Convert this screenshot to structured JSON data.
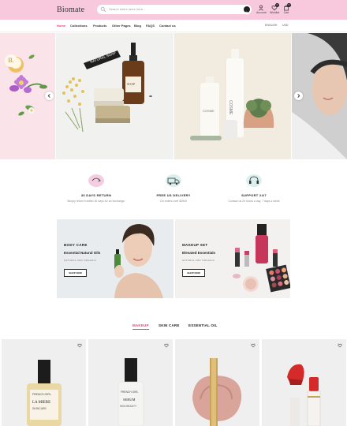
{
  "header": {
    "logo": "Biomate",
    "search": {
      "placeholder": "Search entire store here..."
    },
    "actions": [
      {
        "label": "Account",
        "icon": "user-icon"
      },
      {
        "label": "Wishlist",
        "icon": "heart-icon",
        "count": "0"
      },
      {
        "label": "Cart",
        "icon": "bag-icon",
        "count": "0"
      }
    ]
  },
  "nav": {
    "items": [
      {
        "label": "Home",
        "active": true
      },
      {
        "label": "Collections",
        "active": false
      },
      {
        "label": "Products",
        "active": false
      },
      {
        "label": "Other Pages",
        "active": false
      },
      {
        "label": "Blog",
        "active": false
      },
      {
        "label": "FAQS",
        "active": false
      },
      {
        "label": "Contact us",
        "active": false
      }
    ],
    "language": "ENGLISH",
    "currency": "USD"
  },
  "hero": {
    "soap_label_top": "NATURAL SOAP",
    "soap_label": "SOAP",
    "tube_brand": "COSME",
    "jar_brand": "COSME",
    "badge_letter": "B."
  },
  "features": [
    {
      "title": "30 DAYS RETURN",
      "subtitle": "Simply return it within 30 days for an exchange."
    },
    {
      "title": "FREE US DELIVERY",
      "subtitle": "On orders over $2500"
    },
    {
      "title": "SUPPORT 24/7",
      "subtitle": "Contact us 24 hours a day, 7 days a week"
    }
  ],
  "banners": [
    {
      "pretitle": "BODY CARE",
      "title": "Essential Natural Oils",
      "subtitle": "NATURAL AND ORGANIC",
      "button": "SHOP NOW"
    },
    {
      "pretitle": "MAKEUP SET",
      "title": "Elevated Essentials",
      "subtitle": "NATURAL AND ORGANIC",
      "button": "SHOP NOW"
    }
  ],
  "tabs": [
    {
      "label": "MAKEUP",
      "active": true
    },
    {
      "label": "SKIN CARE",
      "active": false
    },
    {
      "label": "ESSENTIAL OIL",
      "active": false
    }
  ],
  "products": [
    {
      "label_top": "FRENCH GIRL",
      "label_main": "LA MIERE",
      "label_sub": "SKINCARE"
    },
    {
      "label_top": "FRENCH GIRL",
      "label_main": "SERUM",
      "label_sub": "SKIN BEAUTY"
    },
    {
      "label_top": "",
      "label_main": "",
      "label_sub": ""
    },
    {
      "label_top": "",
      "label_main": "",
      "label_sub": ""
    }
  ],
  "colors": {
    "accent": "#e0457b",
    "topbar": "#f8c8dc",
    "feature_blob": "#d9f0ee",
    "card_bg": "#efefef"
  }
}
